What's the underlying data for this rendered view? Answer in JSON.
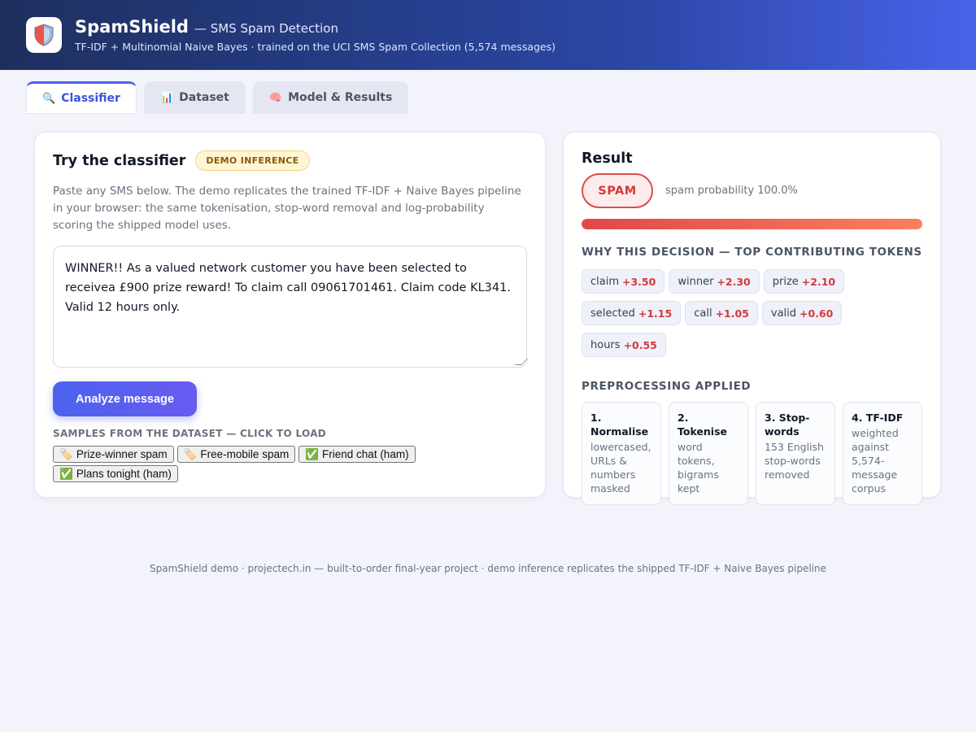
{
  "header": {
    "app_name": "SpamShield",
    "app_subtitle": "— SMS Spam Detection",
    "description": "TF-IDF + Multinomial Naive Bayes · trained on the UCI SMS Spam Collection (5,574 messages)",
    "logo_icon": "shield-icon"
  },
  "tabs": [
    {
      "label": "Classifier",
      "icon": "🔍",
      "active": true
    },
    {
      "label": "Dataset",
      "icon": "📊",
      "active": false
    },
    {
      "label": "Model & Results",
      "icon": "🧠",
      "active": false
    }
  ],
  "classifier": {
    "title": "Try the classifier",
    "badge": "DEMO INFERENCE",
    "description": "Paste any SMS below. The demo replicates the trained TF-IDF + Naive Bayes pipeline in your browser: the same tokenisation, stop-word removal and log-probability scoring the shipped model uses.",
    "message": "WINNER!! As a valued network customer you have been selected to receivea £900 prize reward! To claim call 09061701461. Claim code KL341. Valid 12 hours only.",
    "analyze_label": "Analyze message",
    "samples_label": "SAMPLES FROM THE DATASET — CLICK TO LOAD",
    "samples": [
      {
        "icon": "🏷️",
        "label": "Prize-winner spam"
      },
      {
        "icon": "🏷️",
        "label": "Free-mobile spam"
      },
      {
        "icon": "✅",
        "label": "Friend chat (ham)"
      },
      {
        "icon": "✅",
        "label": "Plans tonight (ham)"
      }
    ]
  },
  "result": {
    "title": "Result",
    "verdict": "SPAM",
    "probability_text": "spam probability 100.0%",
    "probability": 1.0,
    "tokens_label": "WHY THIS DECISION — TOP CONTRIBUTING TOKENS",
    "tokens": [
      {
        "word": "claim",
        "weight": "+3.50"
      },
      {
        "word": "winner",
        "weight": "+2.30"
      },
      {
        "word": "prize",
        "weight": "+2.10"
      },
      {
        "word": "selected",
        "weight": "+1.15"
      },
      {
        "word": "call",
        "weight": "+1.05"
      },
      {
        "word": "valid",
        "weight": "+0.60"
      },
      {
        "word": "hours",
        "weight": "+0.55"
      }
    ],
    "preprocessing_label": "PREPROCESSING APPLIED",
    "steps": [
      {
        "title": "1. Normalise",
        "text": "lowercased, URLs & numbers masked"
      },
      {
        "title": "2. Tokenise",
        "text": "word tokens, bigrams kept"
      },
      {
        "title": "3. Stop-words",
        "text": "153 English stop-words removed"
      },
      {
        "title": "4. TF-IDF",
        "text": "weighted against 5,574-message corpus"
      }
    ]
  },
  "footer": "SpamShield demo · projectech.in — built-to-order final-year project · demo inference replicates the shipped TF-IDF + Naive Bayes pipeline",
  "colors": {
    "accent": "#4b63ef",
    "spam": "#d33a3a",
    "header_dark": "#1e2f5e"
  }
}
